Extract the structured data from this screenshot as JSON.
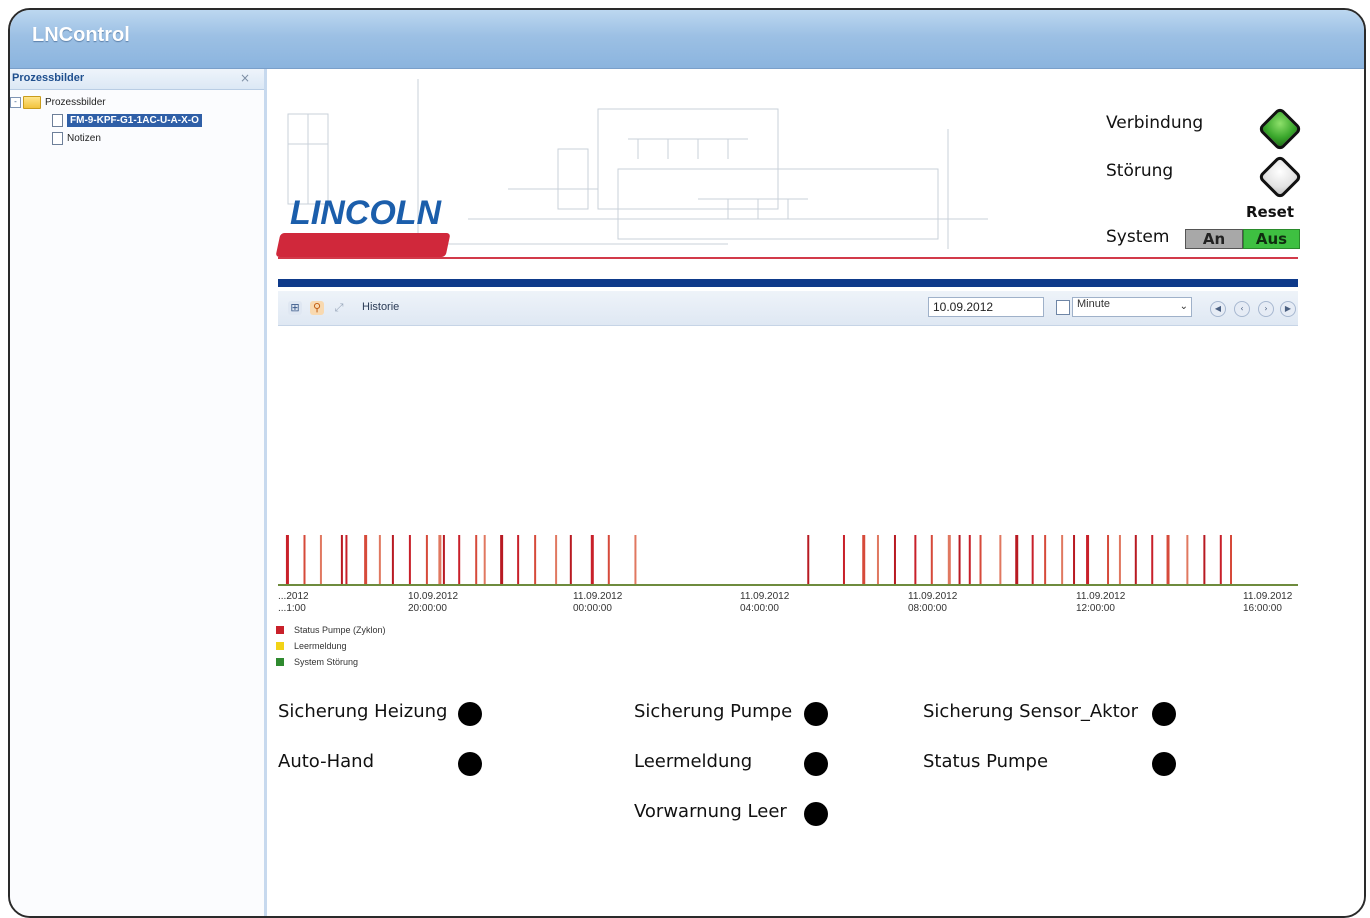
{
  "window": {
    "title": "LNControl"
  },
  "sidebar": {
    "header": "Prozessbilder",
    "close_glyph": "×",
    "tree": [
      {
        "label": "Prozessbilder",
        "icon": "folder-icon",
        "expander": "-"
      },
      {
        "label": "FM-9-KPF-G1-1AC-U-A-X-O",
        "icon": "doc-icon",
        "selected": true
      },
      {
        "label": "Notizen",
        "icon": "doc-icon"
      }
    ]
  },
  "header": {
    "brand": "LINCOLN",
    "status": [
      {
        "label": "Verbindung",
        "indicator": "green",
        "color": "#3aa72c"
      },
      {
        "label": "Störung",
        "indicator": "white",
        "color": "#ffffff"
      }
    ],
    "reset_label": "Reset",
    "system_label": "System",
    "system_on": "An",
    "system_off": "Aus"
  },
  "toolbar": {
    "history_label": "Historie",
    "date_value": "10.09.2012",
    "interval_value": "Minute"
  },
  "chart_data": {
    "type": "bar",
    "title": "",
    "x_tick_labels": [
      [
        "...2012",
        "...1:00"
      ],
      [
        "10.09.2012",
        "20:00:00"
      ],
      [
        "11.09.2012",
        "00:00:00"
      ],
      [
        "11.09.2012",
        "04:00:00"
      ],
      [
        "11.09.2012",
        "08:00:00"
      ],
      [
        "11.09.2012",
        "12:00:00"
      ],
      [
        "11.09.2012",
        "16:00:00"
      ]
    ],
    "x_range_hours": [
      -1,
      17
    ],
    "events_hours": [
      -0.86,
      -0.55,
      -0.26,
      0.11,
      0.19,
      0.52,
      0.78,
      1.01,
      1.31,
      1.61,
      1.83,
      1.91,
      2.18,
      2.48,
      2.63,
      2.92,
      3.22,
      3.52,
      3.89,
      4.15,
      4.52,
      4.82,
      5.29,
      8.34,
      8.97,
      9.31,
      9.57,
      9.87,
      10.23,
      10.52,
      10.82,
      11.01,
      11.19,
      11.38,
      11.73,
      12.01,
      12.3,
      12.52,
      12.82,
      13.03,
      13.26,
      13.63,
      13.84,
      14.12,
      14.41,
      14.68,
      15.03,
      15.33,
      15.62,
      15.8
    ],
    "series": [
      {
        "name": "Status Pumpe (Zyklon)",
        "color": "#c8202a"
      },
      {
        "name": "Leermeldung",
        "color": "#f2d316"
      },
      {
        "name": "System Störung",
        "color": "#2f8a2f"
      }
    ],
    "legend_position": "bottom-left"
  },
  "indicators": [
    {
      "label": "Sicherung Heizung",
      "state": "off"
    },
    {
      "label": "Auto-Hand",
      "state": "off"
    },
    {
      "label": "Sicherung Pumpe",
      "state": "off"
    },
    {
      "label": "Leermeldung",
      "state": "off"
    },
    {
      "label": "Vorwarnung Leer",
      "state": "off"
    },
    {
      "label": "Sicherung Sensor_Aktor",
      "state": "off"
    },
    {
      "label": "Status Pumpe",
      "state": "off"
    }
  ]
}
